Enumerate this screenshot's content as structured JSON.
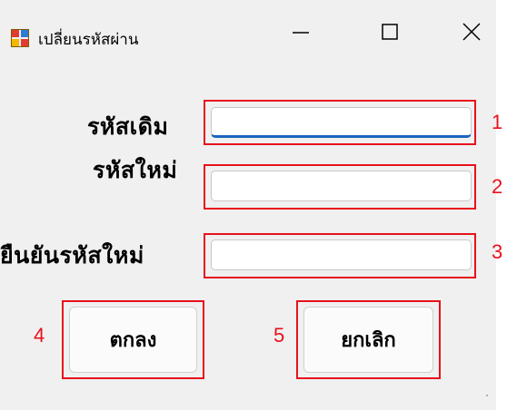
{
  "window": {
    "title": "เปลี่ยนรหัสผ่าน",
    "icon": "form-app-icon",
    "controls": [
      "minimize-icon",
      "maximize-icon",
      "close-icon"
    ]
  },
  "form": {
    "old_password": {
      "label": "รหัสเดิม",
      "value": "",
      "marker": "1"
    },
    "new_password": {
      "label": "รหัสใหม่",
      "value": "",
      "marker": "2"
    },
    "confirm_password": {
      "label": "ยืนยันรหัสใหม่",
      "value": "",
      "marker": "3"
    }
  },
  "buttons": {
    "ok": {
      "label": "ตกลง",
      "marker": "4"
    },
    "cancel": {
      "label": "ยกเลิก",
      "marker": "5"
    }
  },
  "colors": {
    "highlight": "#e8111c",
    "focus": "#1a64bf",
    "background": "#f0f0f0"
  }
}
